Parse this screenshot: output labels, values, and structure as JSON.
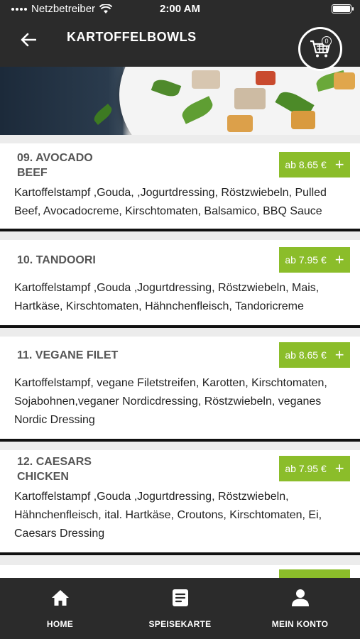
{
  "status_bar": {
    "carrier": "Netzbetreiber",
    "time": "2:00 AM",
    "battery_level": 1.0
  },
  "header": {
    "title": "KARTOFFELBOWLS",
    "cart_count": "0"
  },
  "menu_items": [
    {
      "name": "09. AVOCADO BEEF",
      "price": "ab 8.65 €",
      "description": "Kartoffelstampf ,Gouda, ,Jogurtdressing, Röstzwiebeln, Pulled Beef, Avocadocreme, Kirschtomaten, Balsamico, BBQ Sauce"
    },
    {
      "name": "10. TANDOORI",
      "price": "ab 7.95 €",
      "description": "Kartoffelstampf ,Gouda ,Jogurtdressing, Röstzwiebeln, Mais, Hartkäse, Kirschtomaten, Hähnchenfleisch, Tandoricreme"
    },
    {
      "name": "11. VEGANE FILET",
      "price": "ab 8.65 €",
      "description": "Kartoffelstampf, vegane Filetstreifen, Karotten, Kirschtomaten, Sojabohnen,veganer Nordicdressing, Röstzwiebeln, veganes Nordic Dressing"
    },
    {
      "name": "12. CAESARS CHICKEN",
      "price": "ab 7.95 €",
      "description": "Kartoffelstampf ,Gouda ,Jogurtdressing, Röstzwiebeln, Hähnchenfleisch, ital. Hartkäse, Croutons, Kirschtomaten, Ei, Caesars Dressing"
    }
  ],
  "bottom_nav": [
    {
      "label": "HOME",
      "icon": "home-icon"
    },
    {
      "label": "SPEISEKARTE",
      "icon": "menu-card-icon"
    },
    {
      "label": "MEIN KONTO",
      "icon": "user-icon"
    }
  ],
  "colors": {
    "bar": "#2b2b2b",
    "accent": "#8bbd2a",
    "card": "#ffffff"
  }
}
